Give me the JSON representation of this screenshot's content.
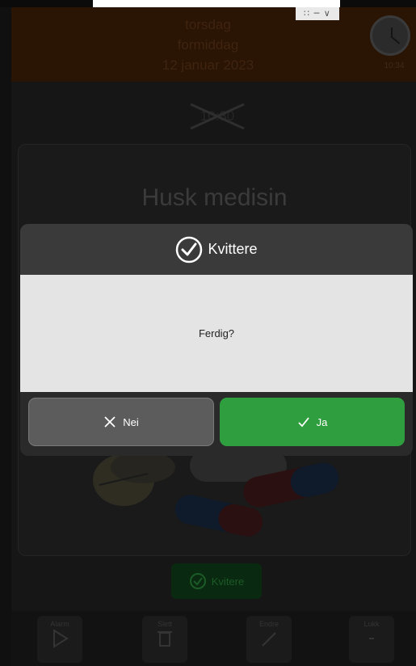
{
  "header": {
    "day": "torsdag",
    "period": "formiddag",
    "date": "12 januar 2023",
    "clock_time": "10:34"
  },
  "window_controls": "∷ ─ ∨",
  "activity": {
    "crossed_time": "10:30",
    "title": "Husk medisin",
    "quit_label": "Kvitere"
  },
  "toolbar": {
    "items": [
      {
        "label": "Alarm",
        "icon": "play-icon"
      },
      {
        "label": "Slett",
        "icon": "trash-icon"
      },
      {
        "label": "Endre",
        "icon": "pencil-icon"
      },
      {
        "label": "Lukk",
        "icon": "close-icon"
      }
    ]
  },
  "dialog": {
    "title": "Kvittere",
    "message": "Ferdig?",
    "no_label": "Nei",
    "yes_label": "Ja",
    "colors": {
      "header": "#3a3a3a",
      "body": "#e4e4e4",
      "no_button": "#5c5c5c",
      "yes_button": "#2f9e3e"
    }
  }
}
